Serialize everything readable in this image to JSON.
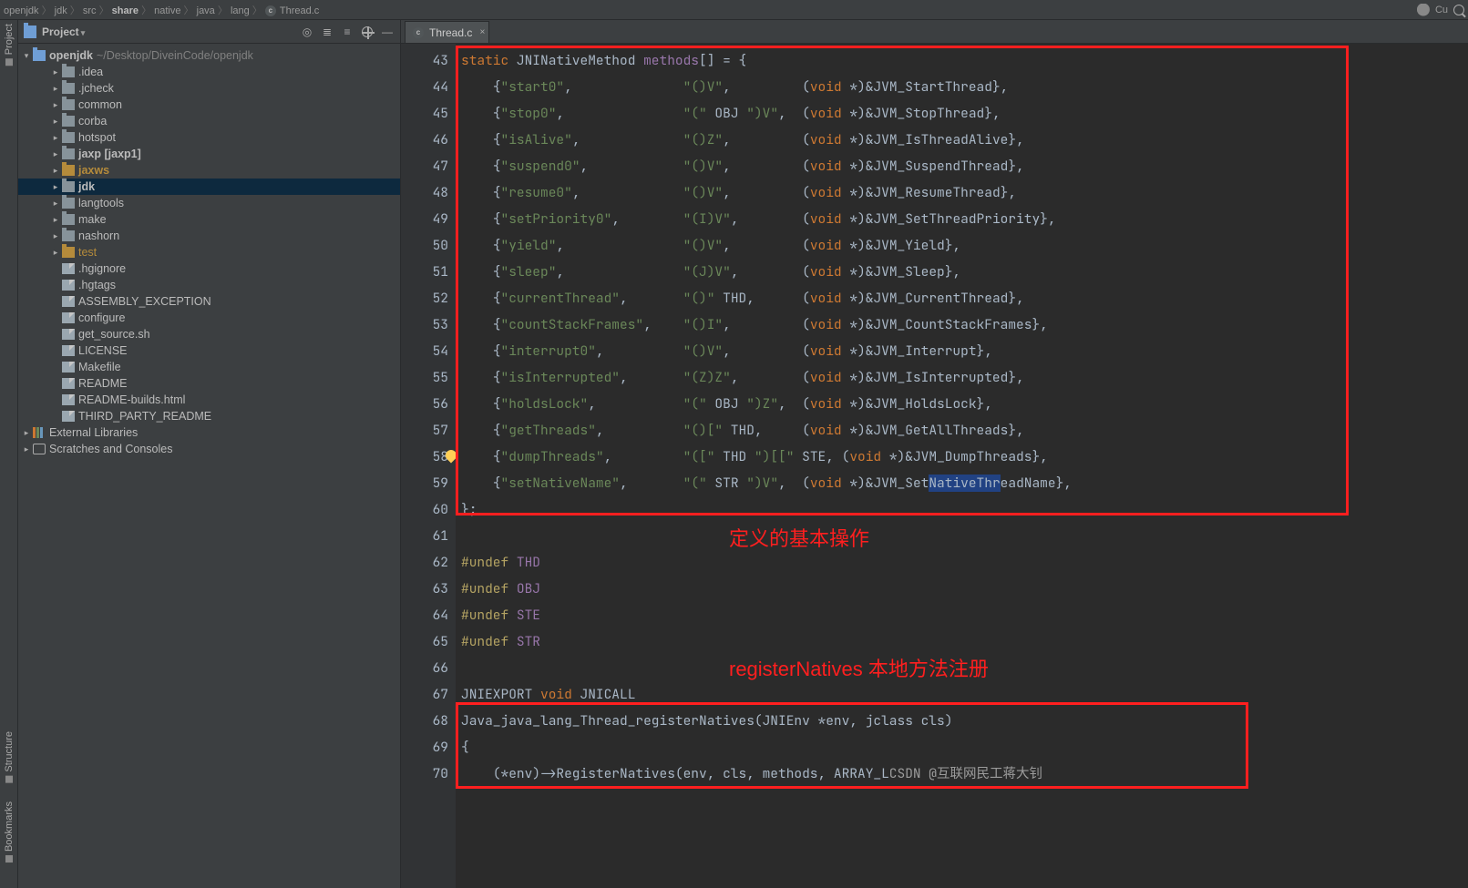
{
  "breadcrumb": [
    "openjdk",
    "jdk",
    "src",
    "share",
    "native",
    "java",
    "lang",
    "Thread.c"
  ],
  "breadcrumb_icon": "c-file-icon",
  "topright": {
    "user": "Cu"
  },
  "project_panel": {
    "title": "Project",
    "root": {
      "label": "openjdk",
      "hint": "~/Desktop/DiveinCode/openjdk"
    },
    "dirs": [
      {
        "l": ".idea",
        "t": "folder",
        "bold": false
      },
      {
        "l": ".jcheck",
        "t": "folder"
      },
      {
        "l": "common",
        "t": "folder"
      },
      {
        "l": "corba",
        "t": "folder"
      },
      {
        "l": "hotspot",
        "t": "folder"
      },
      {
        "l": "jaxp [jaxp1]",
        "t": "folder",
        "bold": true
      },
      {
        "l": "jaxws",
        "t": "folder",
        "bold": true,
        "gold": true
      },
      {
        "l": "jdk",
        "t": "folder",
        "bold": true,
        "sel": true
      },
      {
        "l": "langtools",
        "t": "folder"
      },
      {
        "l": "make",
        "t": "folder"
      },
      {
        "l": "nashorn",
        "t": "folder"
      },
      {
        "l": "test",
        "t": "folder",
        "gold": true
      }
    ],
    "files": [
      {
        "l": ".hgignore",
        "t": "txt"
      },
      {
        "l": ".hgtags",
        "t": "txt"
      },
      {
        "l": "ASSEMBLY_EXCEPTION",
        "t": "txt"
      },
      {
        "l": "configure",
        "t": "txt"
      },
      {
        "l": "get_source.sh",
        "t": "txt"
      },
      {
        "l": "LICENSE",
        "t": "txt"
      },
      {
        "l": "Makefile",
        "t": "txt"
      },
      {
        "l": "README",
        "t": "txt"
      },
      {
        "l": "README-builds.html",
        "t": "txt"
      },
      {
        "l": "THIRD_PARTY_README",
        "t": "txt"
      }
    ],
    "bottom": [
      {
        "l": "External Libraries",
        "t": "lib"
      },
      {
        "l": "Scratches and Consoles",
        "t": "scratch"
      }
    ]
  },
  "leftbar": {
    "project": "Project",
    "structure": "Structure",
    "bookmarks": "Bookmarks"
  },
  "tab": {
    "name": "Thread.c"
  },
  "code": {
    "first_line": 43,
    "methods": [
      {
        "name": "start0",
        "sig": "\"()V\"",
        "jvm": "JVM_StartThread"
      },
      {
        "name": "stop0",
        "sig": "\"(\" OBJ \")V\"",
        "jvm": "JVM_StopThread"
      },
      {
        "name": "isAlive",
        "sig": "\"()Z\"",
        "jvm": "JVM_IsThreadAlive"
      },
      {
        "name": "suspend0",
        "sig": "\"()V\"",
        "jvm": "JVM_SuspendThread"
      },
      {
        "name": "resume0",
        "sig": "\"()V\"",
        "jvm": "JVM_ResumeThread"
      },
      {
        "name": "setPriority0",
        "sig": "\"(I)V\"",
        "jvm": "JVM_SetThreadPriority"
      },
      {
        "name": "yield",
        "sig": "\"()V\"",
        "jvm": "JVM_Yield"
      },
      {
        "name": "sleep",
        "sig": "\"(J)V\"",
        "jvm": "JVM_Sleep"
      },
      {
        "name": "currentThread",
        "sig": "\"()\" THD",
        "jvm": "JVM_CurrentThread"
      },
      {
        "name": "countStackFrames",
        "sig": "\"()I\"",
        "jvm": "JVM_CountStackFrames"
      },
      {
        "name": "interrupt0",
        "sig": "\"()V\"",
        "jvm": "JVM_Interrupt"
      },
      {
        "name": "isInterrupted",
        "sig": "\"(Z)Z\"",
        "jvm": "JVM_IsInterrupted"
      },
      {
        "name": "holdsLock",
        "sig": "\"(\" OBJ \")Z\"",
        "jvm": "JVM_HoldsLock"
      },
      {
        "name": "getThreads",
        "sig": "\"()[\" THD",
        "jvm": "JVM_GetAllThreads"
      },
      {
        "name": "dumpThreads",
        "sig": "\"([\" THD \")[[\" STE",
        "jvm": "JVM_DumpThreads"
      },
      {
        "name": "setNativeName",
        "sig": "\"(\" STR \")V\"",
        "jvm": "JVM_SetNativeThreadName"
      }
    ],
    "undefs": [
      "THD",
      "OBJ",
      "STE",
      "STR"
    ],
    "fn_decl_kw": "JNIEXPORT",
    "fn_decl_ret": "void",
    "fn_decl_call": "JNICALL",
    "fn_name": "Java_java_lang_Thread_registerNatives",
    "fn_args": "(JNIEnv *env, jclass cls)",
    "body_line": "(*env)->RegisterNatives(env, cls, methods, ARRAY_LENGTH(methods));",
    "highlight": "NativeThr"
  },
  "annotations": {
    "box1_label": "定义的基本操作",
    "box2_label": "registerNatives 本地方法注册"
  },
  "watermark": "CSDN @互联网民工蒋大钊"
}
